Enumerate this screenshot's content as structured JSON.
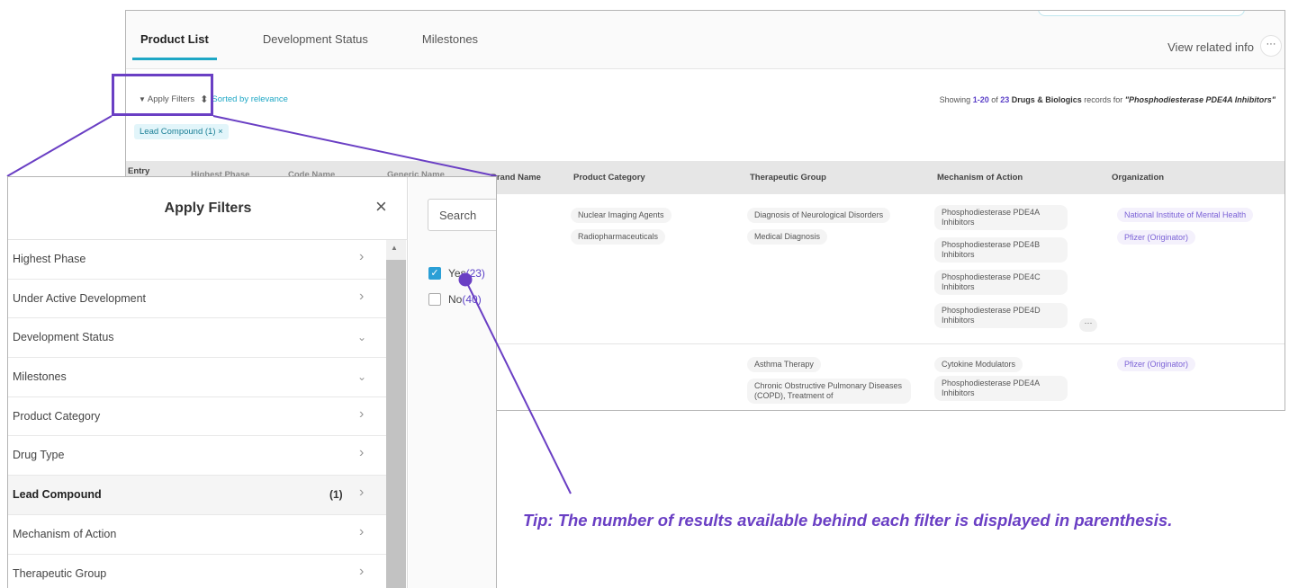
{
  "app": {
    "tabs": [
      {
        "label": "Product List",
        "active": true
      },
      {
        "label": "Development Status",
        "active": false
      },
      {
        "label": "Milestones",
        "active": false
      }
    ],
    "related_info": "View related info",
    "more": "···"
  },
  "toolbar": {
    "apply_filters": "Apply Filters",
    "sort_arrows": "⬍",
    "sorted_by": "Sorted by relevance"
  },
  "results": {
    "showing_prefix": "Showing ",
    "range": "1-20",
    "of": " of ",
    "count": "23",
    "kind": " Drugs & Biologics",
    "records_for": " records for ",
    "query": "\"Phosphodiesterase PDE4A Inhibitors\""
  },
  "active_filter_chip": "Lead Compound  (1)  ×",
  "table": {
    "columns": [
      "Entry",
      "Highest Phase",
      "Code Name",
      "Generic Name",
      "Brand Name",
      "Product Category",
      "Therapeutic Group",
      "Mechanism of Action",
      "Organization"
    ],
    "rows": [
      {
        "product_category": [
          "Nuclear Imaging Agents",
          "Radiopharmaceuticals"
        ],
        "therapeutic_group": [
          "Diagnosis of Neurological Disorders",
          "Medical Diagnosis"
        ],
        "mechanism_of_action": [
          "Phosphodiesterase PDE4A Inhibitors",
          "Phosphodiesterase PDE4B Inhibitors",
          "Phosphodiesterase PDE4C Inhibitors",
          "Phosphodiesterase PDE4D Inhibitors"
        ],
        "organization": [
          "National Institute of Mental Health",
          "Pfizer (Originator)"
        ],
        "more": "···"
      },
      {
        "therapeutic_group": [
          "Asthma Therapy",
          "Chronic Obstructive Pulmonary Diseases (COPD), Treatment of"
        ],
        "mechanism_of_action": [
          "Cytokine Modulators",
          "Phosphodiesterase PDE4A Inhibitors"
        ],
        "organization": [
          "Pfizer (Originator)"
        ]
      }
    ]
  },
  "filter_panel": {
    "title": "Apply Filters",
    "close": "×",
    "items": [
      {
        "label": "Highest Phase",
        "chevron": "›",
        "count": ""
      },
      {
        "label": "Under Active Development",
        "chevron": "›",
        "count": ""
      },
      {
        "label": "Development Status",
        "chevron": "⌄",
        "count": ""
      },
      {
        "label": "Milestones",
        "chevron": "⌄",
        "count": ""
      },
      {
        "label": "Product Category",
        "chevron": "›",
        "count": ""
      },
      {
        "label": "Drug Type",
        "chevron": "›",
        "count": ""
      },
      {
        "label": "Lead Compound",
        "chevron": "›",
        "count": "(1)"
      },
      {
        "label": "Mechanism of Action",
        "chevron": "›",
        "count": ""
      },
      {
        "label": "Therapeutic Group",
        "chevron": "›",
        "count": ""
      }
    ],
    "search_placeholder": "Search",
    "options": [
      {
        "label": "Yes",
        "count": "(23)",
        "checked": true
      },
      {
        "label": "No",
        "count": "(40)",
        "checked": false
      }
    ]
  },
  "tip": "Tip: The number of results available behind each filter is displayed in parenthesis.",
  "colors": {
    "accent": "#1ea7c5",
    "callout": "#6a3fc4",
    "checkbox": "#2a9fd6",
    "count_link": "#5b40c8"
  }
}
